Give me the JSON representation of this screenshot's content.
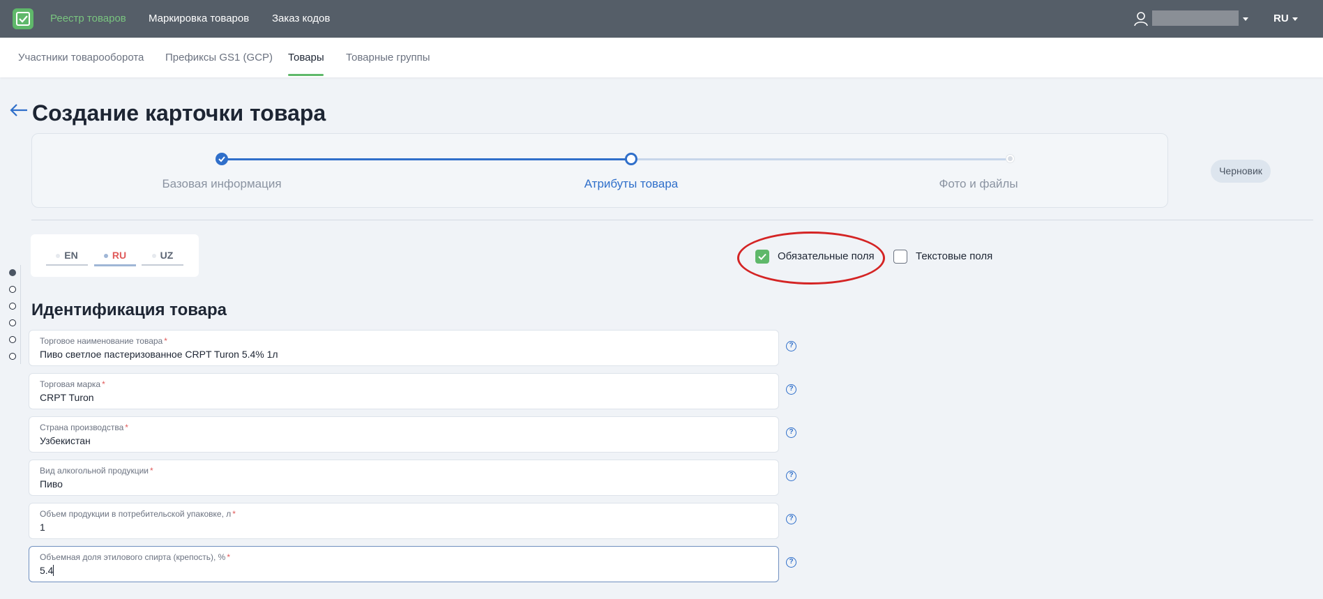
{
  "topbar": {
    "nav": [
      "Реестр товаров",
      "Маркировка товаров",
      "Заказ кодов"
    ],
    "active_index": 0,
    "language": "RU"
  },
  "subnav": {
    "tabs": [
      "Участники товарооборота",
      "Префиксы GS1 (GCP)",
      "Товары",
      "Товарные группы"
    ],
    "active_index": 2
  },
  "page": {
    "title": "Создание карточки товара"
  },
  "stepper": {
    "steps": [
      "Базовая информация",
      "Атрибуты товара",
      "Фото и файлы"
    ],
    "current_index": 1
  },
  "status": {
    "draft_label": "Черновик"
  },
  "lang_tabs": {
    "items": [
      "EN",
      "RU",
      "UZ"
    ],
    "active_index": 1
  },
  "filters": {
    "required_fields": {
      "label": "Обязательные поля",
      "checked": true
    },
    "text_fields": {
      "label": "Текстовые поля",
      "checked": false
    }
  },
  "section": {
    "title": "Идентификация товара"
  },
  "fields": [
    {
      "label": "Торговое наименование товара",
      "value": "Пиво светлое пастеризованное CRPT Turon 5.4% 1л",
      "required": "*"
    },
    {
      "label": "Торговая марка",
      "value": "CRPT Turon",
      "required": "*"
    },
    {
      "label": "Страна производства",
      "value": "Узбекистан",
      "required": "*"
    },
    {
      "label": "Вид алкогольной продукции",
      "value": "Пиво",
      "required": "*"
    },
    {
      "label": "Объем продукции в потребительской упаковке, л",
      "value": "1",
      "required": "*"
    },
    {
      "label": "Объемная доля этилового спирта (крепость), %",
      "value": "5.4",
      "required": "*"
    }
  ],
  "help_glyph": "?",
  "colors": {
    "topbar": "#555e68",
    "accent_green": "#5fb86a",
    "accent_blue": "#2f6fca",
    "highlight_red": "#d42424"
  },
  "icons": [
    "logo-icon",
    "user-icon",
    "chevron-down-icon",
    "back-arrow-icon",
    "check-icon",
    "help-icon"
  ]
}
